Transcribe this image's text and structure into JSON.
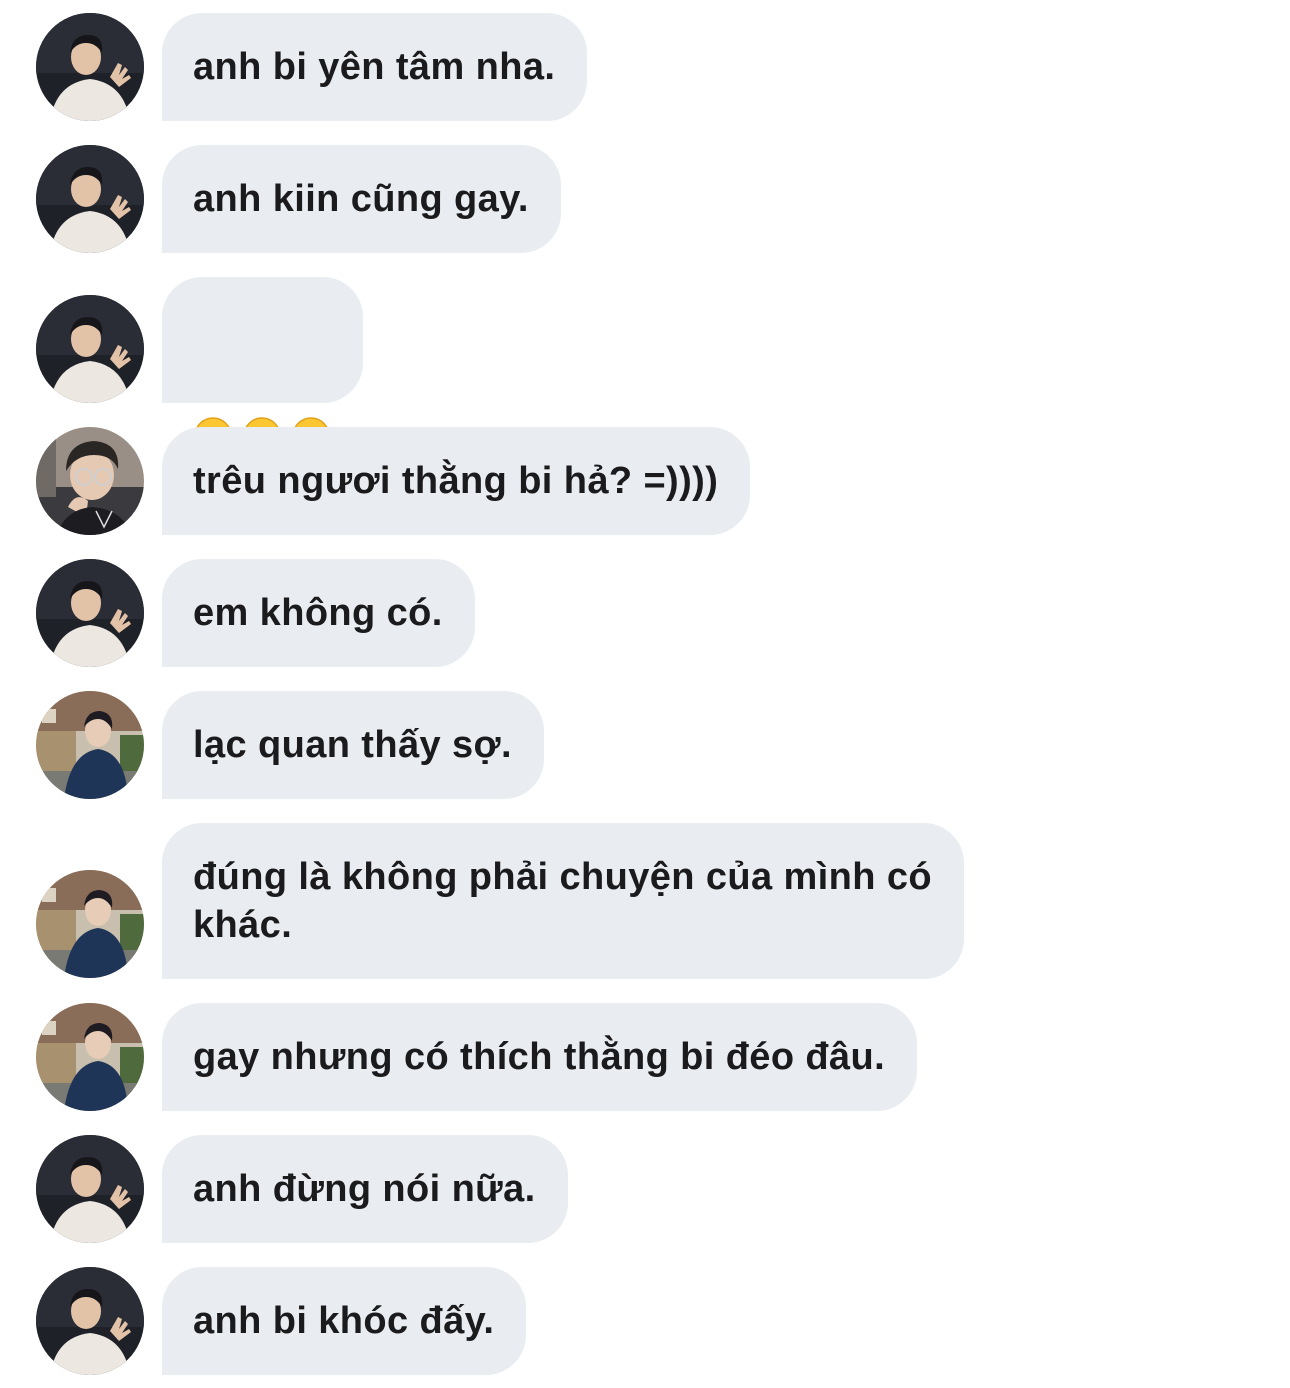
{
  "messages": [
    {
      "sender": "avatar-a",
      "text": "anh bi yên tâm nha."
    },
    {
      "sender": "avatar-a",
      "text": "anh kiin cũng gay."
    },
    {
      "sender": "avatar-a",
      "text": "",
      "emoji": [
        "smiling-face-icon",
        "smiling-face-icon",
        "smiling-face-icon"
      ]
    },
    {
      "sender": "avatar-b",
      "text": "trêu ngươi thằng bi hả? =))))"
    },
    {
      "sender": "avatar-a",
      "text": "em không có."
    },
    {
      "sender": "avatar-c",
      "text": "lạc quan thấy sợ."
    },
    {
      "sender": "avatar-c",
      "text": "đúng là không phải chuyện của mình có\nkhác."
    },
    {
      "sender": "avatar-c",
      "text": "gay nhưng có thích thằng bi đéo đâu."
    },
    {
      "sender": "avatar-a",
      "text": "anh đừng nói nữa."
    },
    {
      "sender": "avatar-a",
      "text": "anh bi khóc đấy."
    }
  ],
  "colors": {
    "bubble": "#e9edf1",
    "text": "#1b1b1d",
    "background": "#ffffff"
  }
}
